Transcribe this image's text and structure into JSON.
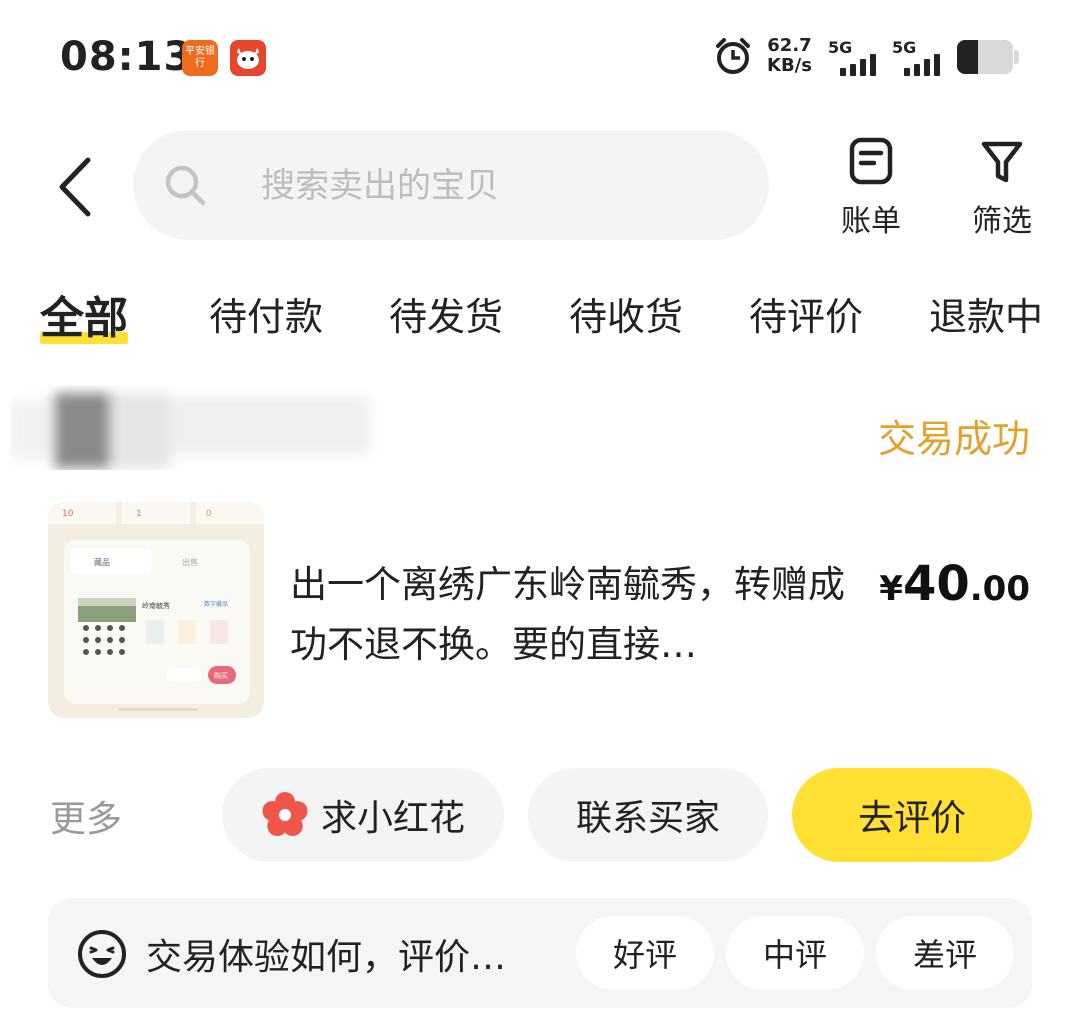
{
  "status_bar": {
    "time": "08:13",
    "app_icons": [
      "平安银行",
      "fox-mascot-icon"
    ],
    "net_speed_value": "62.7",
    "net_speed_unit": "KB/s",
    "signal_1": "5G",
    "signal_2": "5G",
    "battery_level": 0.38
  },
  "header": {
    "search_placeholder": "搜索卖出的宝贝",
    "bill_label": "账单",
    "filter_label": "筛选"
  },
  "tabs": [
    {
      "label": "全部",
      "active": true
    },
    {
      "label": "待付款",
      "active": false
    },
    {
      "label": "待发货",
      "active": false
    },
    {
      "label": "待收货",
      "active": false
    },
    {
      "label": "待评价",
      "active": false
    },
    {
      "label": "退款中",
      "active": false
    }
  ],
  "order": {
    "status": "交易成功",
    "title": "出一个离绣广东岭南毓秀，转赠成功不退不换。要的直接…",
    "price_currency": "¥",
    "price_integer": "40",
    "price_decimal": ".00",
    "thumbnail": {
      "top_numbers": [
        "10",
        "1",
        "0"
      ],
      "tabs": [
        "藏品",
        "出售"
      ],
      "item_name": "岭南毓秀",
      "tag": "数字藏品",
      "button": "购买"
    }
  },
  "actions": {
    "more": "更多",
    "flower_button": "求小红花",
    "contact_button": "联系买家",
    "review_button": "去评价"
  },
  "rating": {
    "prompt": "交易体验如何，评价…",
    "good": "好评",
    "neutral": "中评",
    "bad": "差评"
  },
  "colors": {
    "accent_yellow": "#ffe033",
    "status_orange": "#e3a12d",
    "flower_red": "#f0554a",
    "pill_gray": "#f4f4f4"
  }
}
